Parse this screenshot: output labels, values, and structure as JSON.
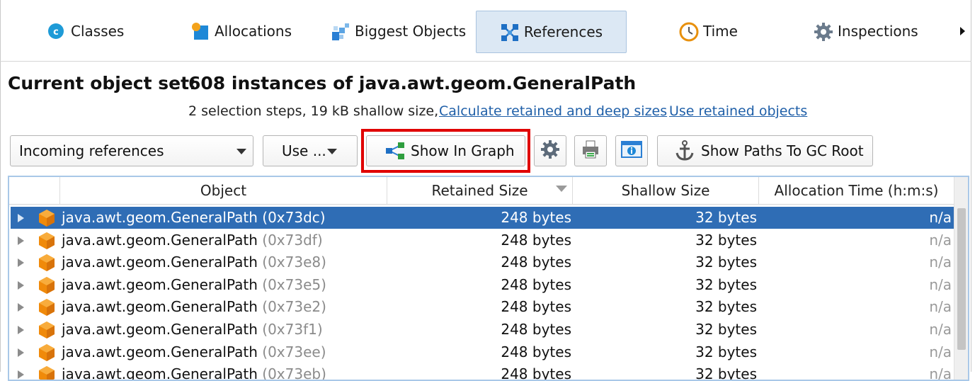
{
  "tabs": [
    {
      "label": "Classes",
      "icon": "classes-icon"
    },
    {
      "label": "Allocations",
      "icon": "allocations-icon"
    },
    {
      "label": "Biggest Objects",
      "icon": "biggest-objects-icon"
    },
    {
      "label": "References",
      "icon": "references-icon",
      "active": true
    },
    {
      "label": "Time",
      "icon": "clock-icon"
    },
    {
      "label": "Inspections",
      "icon": "gear-icon"
    }
  ],
  "header": {
    "label": "Current object set:",
    "value": "608 instances of java.awt.geom.GeneralPath",
    "steps": "2 selection steps, 19 kB shallow size,",
    "link_retained": "Calculate retained and deep sizes",
    "link_use_retained": "Use retained objects"
  },
  "toolbar": {
    "reference_type": "Incoming references",
    "use_label": "Use ...",
    "show_in_graph": "Show In Graph",
    "show_paths": "Show Paths To GC Root"
  },
  "table": {
    "columns": [
      "Object",
      "Retained Size",
      "Shallow Size",
      "Allocation Time (h:m:s)"
    ],
    "rows": [
      {
        "name": "java.awt.geom.GeneralPath",
        "addr": "(0x73dc)",
        "retained": "248 bytes",
        "shallow": "32 bytes",
        "alloc": "n/a",
        "selected": true
      },
      {
        "name": "java.awt.geom.GeneralPath",
        "addr": "(0x73df)",
        "retained": "248 bytes",
        "shallow": "32 bytes",
        "alloc": "n/a"
      },
      {
        "name": "java.awt.geom.GeneralPath",
        "addr": "(0x73e8)",
        "retained": "248 bytes",
        "shallow": "32 bytes",
        "alloc": "n/a"
      },
      {
        "name": "java.awt.geom.GeneralPath",
        "addr": "(0x73e5)",
        "retained": "248 bytes",
        "shallow": "32 bytes",
        "alloc": "n/a"
      },
      {
        "name": "java.awt.geom.GeneralPath",
        "addr": "(0x73e2)",
        "retained": "248 bytes",
        "shallow": "32 bytes",
        "alloc": "n/a"
      },
      {
        "name": "java.awt.geom.GeneralPath",
        "addr": "(0x73f1)",
        "retained": "248 bytes",
        "shallow": "32 bytes",
        "alloc": "n/a"
      },
      {
        "name": "java.awt.geom.GeneralPath",
        "addr": "(0x73ee)",
        "retained": "248 bytes",
        "shallow": "32 bytes",
        "alloc": "n/a"
      },
      {
        "name": "java.awt.geom.GeneralPath",
        "addr": "(0x73eb)",
        "retained": "248 bytes",
        "shallow": "32 bytes",
        "alloc": "n/a"
      }
    ]
  },
  "colors": {
    "selection": "#2f6db5",
    "highlight": "#e00000",
    "link": "#1f5fa8",
    "active_tab": "#dce8f4"
  }
}
